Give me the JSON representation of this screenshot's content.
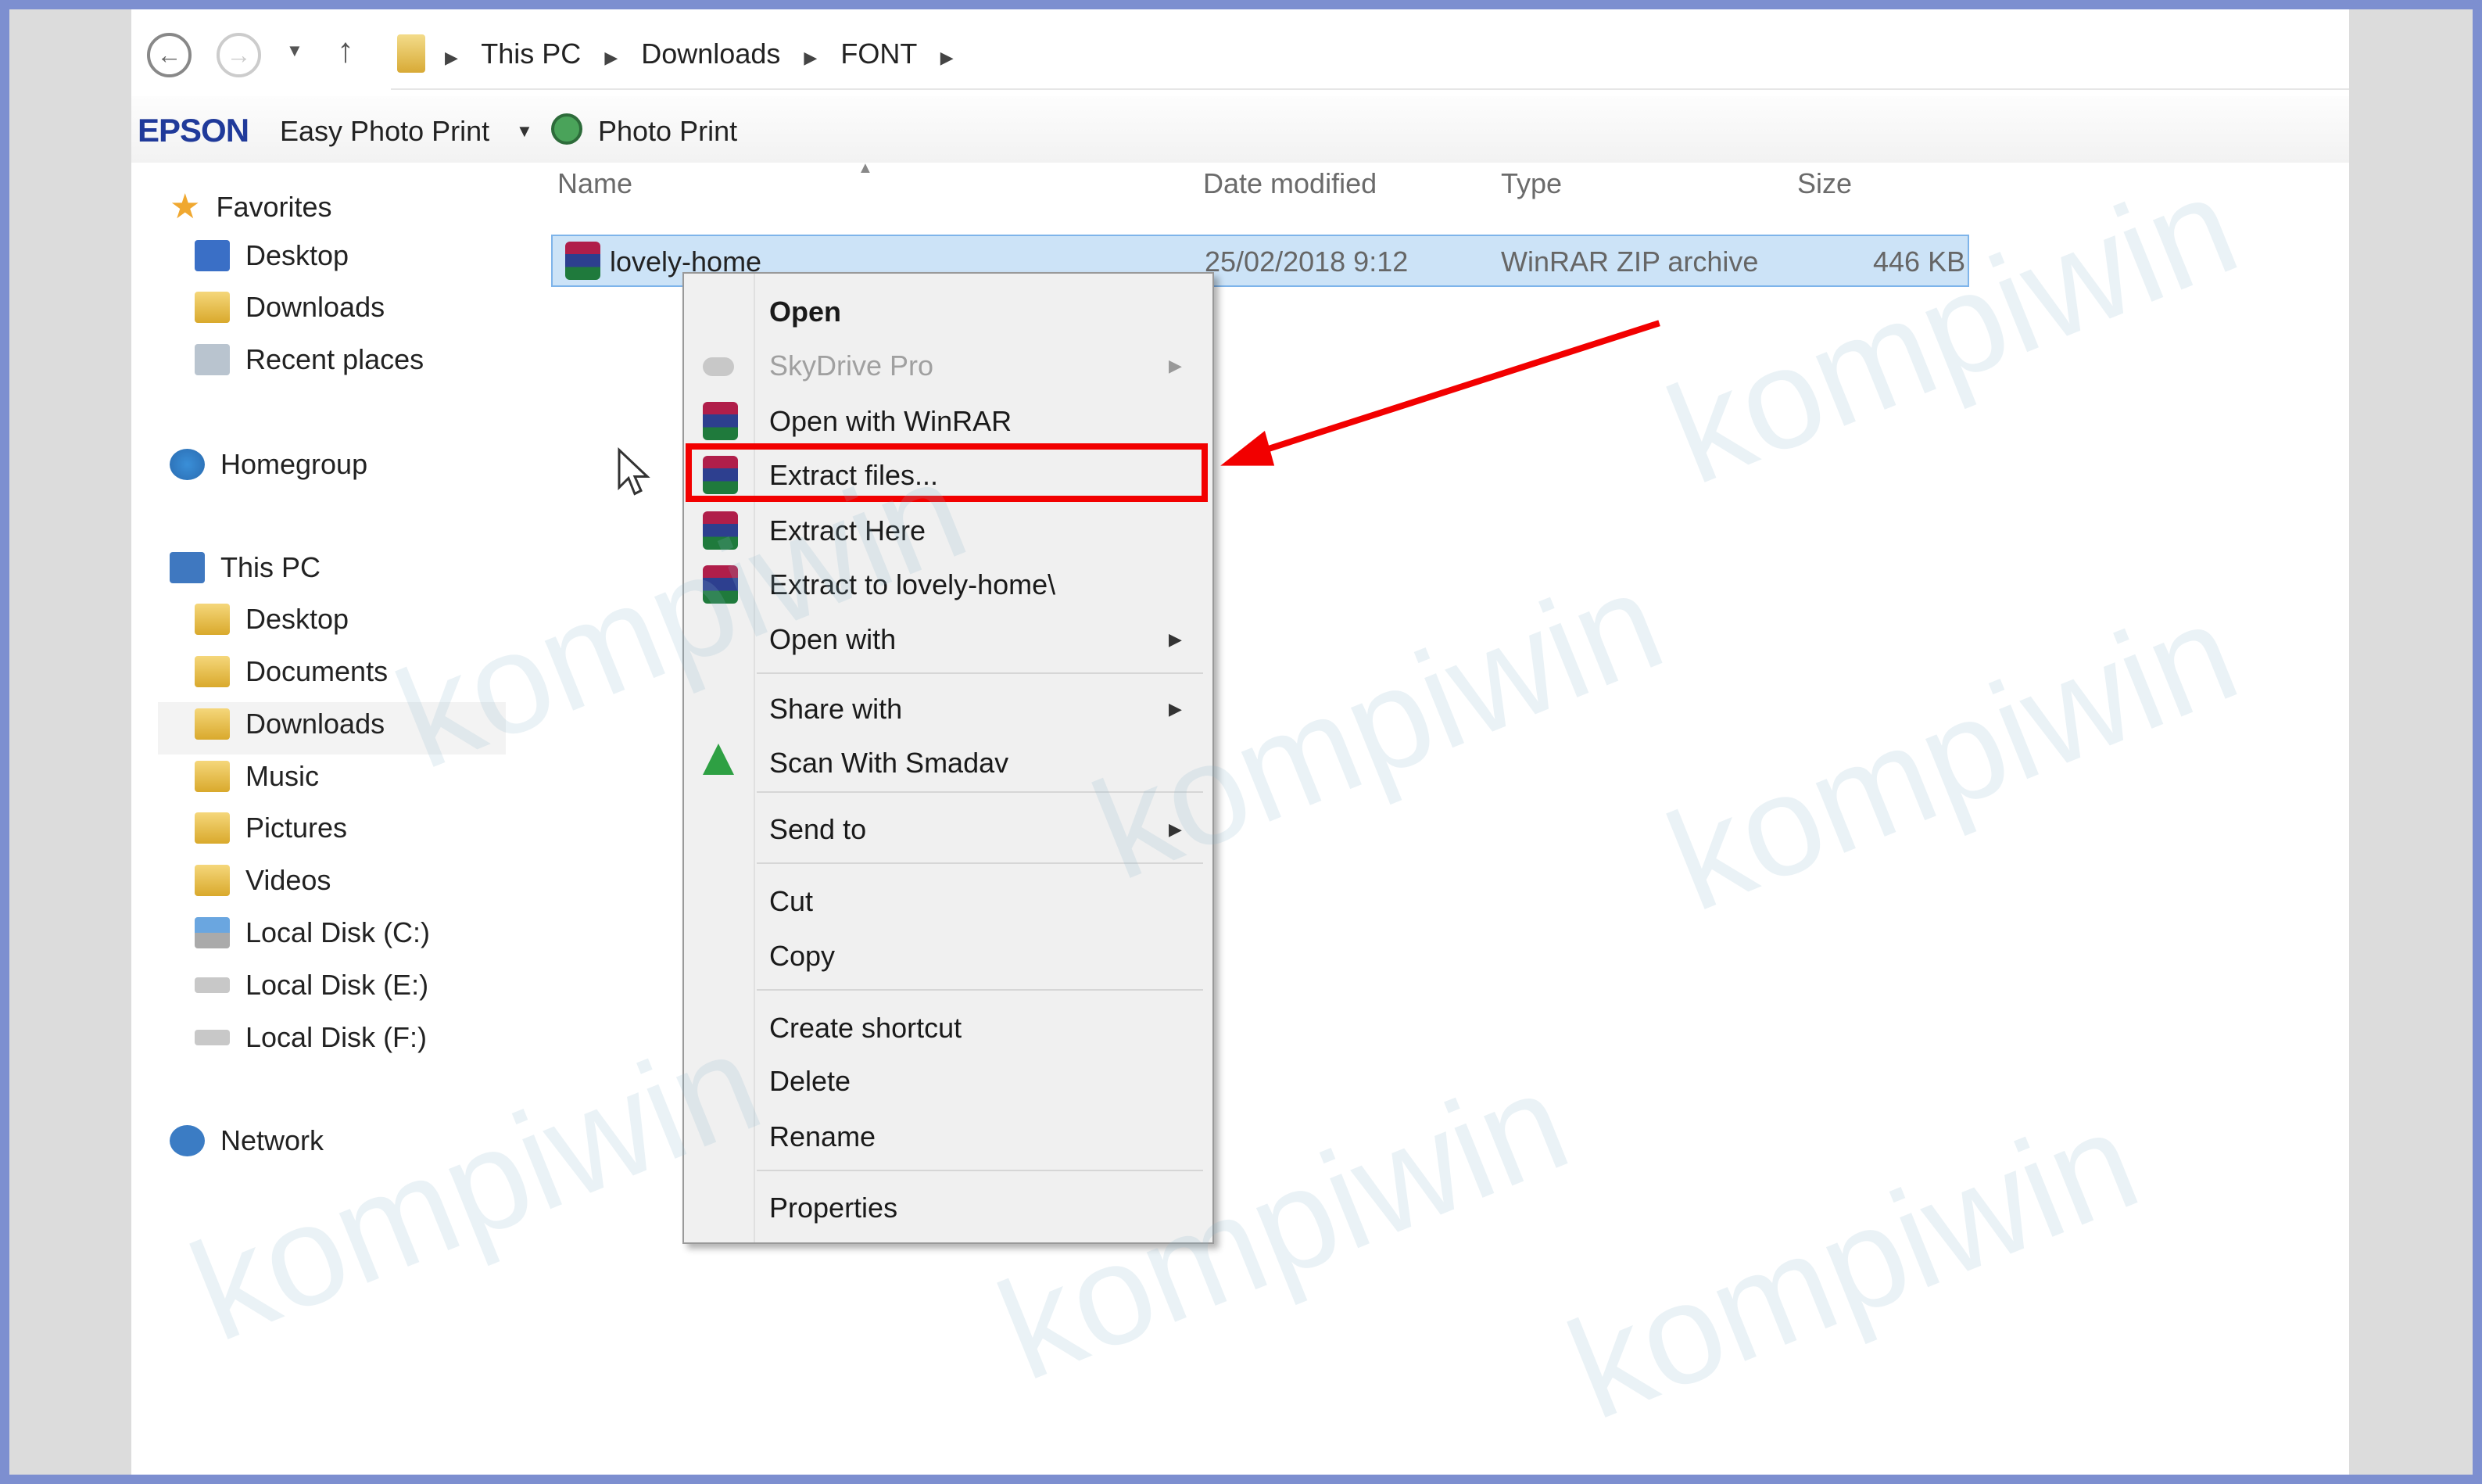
{
  "watermark": "kompiwin",
  "address_bar": {
    "breadcrumbs": [
      "This PC",
      "Downloads",
      "FONT"
    ]
  },
  "toolbar": {
    "brand": "EPSON",
    "easy_photo_print": "Easy Photo Print",
    "photo_print": "Photo Print"
  },
  "columns": {
    "name": "Name",
    "date": "Date modified",
    "type": "Type",
    "size": "Size"
  },
  "file": {
    "name": "lovely-home",
    "date": "25/02/2018 9:12",
    "type": "WinRAR ZIP archive",
    "size": "446 KB"
  },
  "sidebar": {
    "favorites": "Favorites",
    "fav_items": [
      "Desktop",
      "Downloads",
      "Recent places"
    ],
    "homegroup": "Homegroup",
    "this_pc": "This PC",
    "pc_items": [
      "Desktop",
      "Documents",
      "Downloads",
      "Music",
      "Pictures",
      "Videos",
      "Local Disk (C:)",
      "Local Disk (E:)",
      "Local Disk (F:)"
    ],
    "network": "Network"
  },
  "context_menu": {
    "open": "Open",
    "skydrive": "SkyDrive Pro",
    "open_winrar": "Open with WinRAR",
    "extract_files": "Extract files...",
    "extract_here": "Extract Here",
    "extract_to": "Extract to lovely-home\\",
    "open_with": "Open with",
    "share_with": "Share with",
    "scan": "Scan With Smadav",
    "send_to": "Send to",
    "cut": "Cut",
    "copy": "Copy",
    "create_shortcut": "Create shortcut",
    "delete": "Delete",
    "rename": "Rename",
    "properties": "Properties"
  },
  "colors": {
    "highlight": "#f20000",
    "frame": "#7d8fd0",
    "selection": "#cce3f7"
  }
}
